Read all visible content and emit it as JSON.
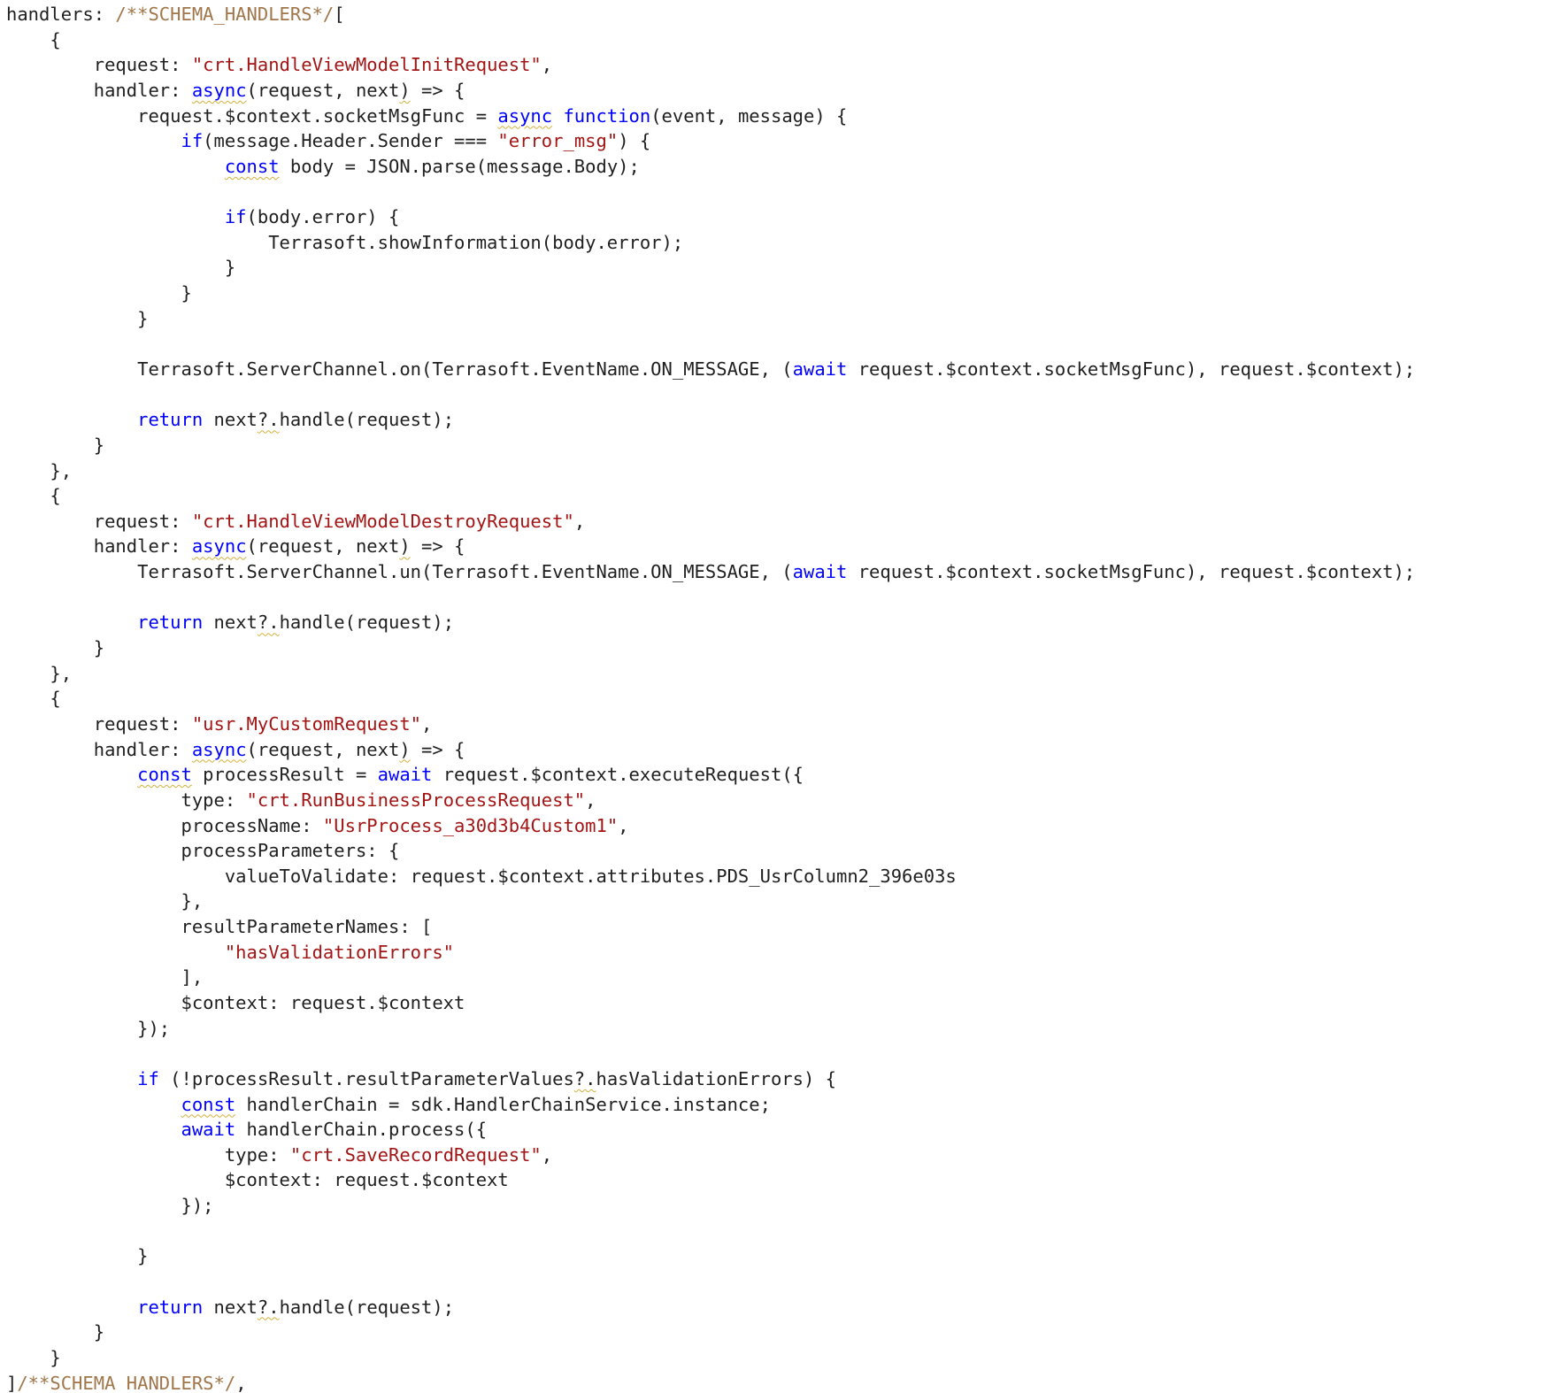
{
  "editor": {
    "colors": {
      "background": "#ffffff",
      "text": "#1f1f1f",
      "keyword": "#0000ff",
      "string": "#a31515",
      "comment": "#a0764a",
      "squiggle": "#d4b13a"
    },
    "lines": [
      [
        {
          "t": "handlers: ",
          "k": "plain"
        },
        {
          "t": "/**SCHEMA_HANDLERS*/",
          "k": "cm"
        },
        {
          "t": "[",
          "k": "plain"
        }
      ],
      [
        {
          "t": "    {",
          "k": "plain"
        }
      ],
      [
        {
          "t": "        request: ",
          "k": "plain"
        },
        {
          "t": "\"crt.HandleViewModelInitRequest\"",
          "k": "str"
        },
        {
          "t": ",",
          "k": "plain"
        }
      ],
      [
        {
          "t": "        handler: ",
          "k": "plain"
        },
        {
          "t": "async",
          "k": "kw",
          "s": true
        },
        {
          "t": "(request, next",
          "k": "plain"
        },
        {
          "t": ")",
          "k": "plain",
          "s": true
        },
        {
          "t": " => {",
          "k": "plain"
        }
      ],
      [
        {
          "t": "            request.$context.socketMsgFunc = ",
          "k": "plain"
        },
        {
          "t": "async",
          "k": "kw",
          "s": true
        },
        {
          "t": " ",
          "k": "plain"
        },
        {
          "t": "function",
          "k": "kw"
        },
        {
          "t": "(event, message) {",
          "k": "plain"
        }
      ],
      [
        {
          "t": "                ",
          "k": "plain"
        },
        {
          "t": "if",
          "k": "kw"
        },
        {
          "t": "(message.Header.Sender === ",
          "k": "plain"
        },
        {
          "t": "\"error_msg\"",
          "k": "str"
        },
        {
          "t": ") {",
          "k": "plain"
        }
      ],
      [
        {
          "t": "                    ",
          "k": "plain"
        },
        {
          "t": "const",
          "k": "kw",
          "s": true
        },
        {
          "t": " body = JSON.parse(message.Body);",
          "k": "plain"
        }
      ],
      [
        {
          "t": "",
          "k": "plain"
        }
      ],
      [
        {
          "t": "                    ",
          "k": "plain"
        },
        {
          "t": "if",
          "k": "kw"
        },
        {
          "t": "(body.error) {",
          "k": "plain"
        }
      ],
      [
        {
          "t": "                        Terrasoft.showInformation(body.error);",
          "k": "plain"
        }
      ],
      [
        {
          "t": "                    }",
          "k": "plain"
        }
      ],
      [
        {
          "t": "                }",
          "k": "plain"
        }
      ],
      [
        {
          "t": "            }",
          "k": "plain"
        }
      ],
      [
        {
          "t": "",
          "k": "plain"
        }
      ],
      [
        {
          "t": "            Terrasoft.ServerChannel.on(Terrasoft.EventName.ON_MESSAGE, (",
          "k": "plain"
        },
        {
          "t": "await",
          "k": "kw"
        },
        {
          "t": " request.$context.socketMsgFunc), request.$context);",
          "k": "plain"
        }
      ],
      [
        {
          "t": "",
          "k": "plain"
        }
      ],
      [
        {
          "t": "            ",
          "k": "plain"
        },
        {
          "t": "return",
          "k": "kw"
        },
        {
          "t": " next",
          "k": "plain"
        },
        {
          "t": "?.",
          "k": "plain",
          "s": true
        },
        {
          "t": "handle(request);",
          "k": "plain"
        }
      ],
      [
        {
          "t": "        }",
          "k": "plain"
        }
      ],
      [
        {
          "t": "    },",
          "k": "plain"
        }
      ],
      [
        {
          "t": "    {",
          "k": "plain"
        }
      ],
      [
        {
          "t": "        request: ",
          "k": "plain"
        },
        {
          "t": "\"crt.HandleViewModelDestroyRequest\"",
          "k": "str"
        },
        {
          "t": ",",
          "k": "plain"
        }
      ],
      [
        {
          "t": "        handler: ",
          "k": "plain"
        },
        {
          "t": "async",
          "k": "kw",
          "s": true
        },
        {
          "t": "(request, next",
          "k": "plain"
        },
        {
          "t": ")",
          "k": "plain",
          "s": true
        },
        {
          "t": " => {",
          "k": "plain"
        }
      ],
      [
        {
          "t": "            Terrasoft.ServerChannel.un(Terrasoft.EventName.ON_MESSAGE, (",
          "k": "plain"
        },
        {
          "t": "await",
          "k": "kw"
        },
        {
          "t": " request.$context.socketMsgFunc), request.$context);",
          "k": "plain"
        }
      ],
      [
        {
          "t": "",
          "k": "plain"
        }
      ],
      [
        {
          "t": "            ",
          "k": "plain"
        },
        {
          "t": "return",
          "k": "kw"
        },
        {
          "t": " next",
          "k": "plain"
        },
        {
          "t": "?.",
          "k": "plain",
          "s": true
        },
        {
          "t": "handle(request);",
          "k": "plain"
        }
      ],
      [
        {
          "t": "        }",
          "k": "plain"
        }
      ],
      [
        {
          "t": "    },",
          "k": "plain"
        }
      ],
      [
        {
          "t": "    {",
          "k": "plain"
        }
      ],
      [
        {
          "t": "        request: ",
          "k": "plain"
        },
        {
          "t": "\"usr.MyCustomRequest\"",
          "k": "str"
        },
        {
          "t": ",",
          "k": "plain"
        }
      ],
      [
        {
          "t": "        handler: ",
          "k": "plain"
        },
        {
          "t": "async",
          "k": "kw",
          "s": true
        },
        {
          "t": "(request, next",
          "k": "plain"
        },
        {
          "t": ")",
          "k": "plain",
          "s": true
        },
        {
          "t": " => {",
          "k": "plain"
        }
      ],
      [
        {
          "t": "            ",
          "k": "plain"
        },
        {
          "t": "const",
          "k": "kw",
          "s": true
        },
        {
          "t": " processResult = ",
          "k": "plain"
        },
        {
          "t": "await",
          "k": "kw"
        },
        {
          "t": " request.$context.executeRequest({",
          "k": "plain"
        }
      ],
      [
        {
          "t": "                type: ",
          "k": "plain"
        },
        {
          "t": "\"crt.RunBusinessProcessRequest\"",
          "k": "str"
        },
        {
          "t": ",",
          "k": "plain"
        }
      ],
      [
        {
          "t": "                processName: ",
          "k": "plain"
        },
        {
          "t": "\"UsrProcess_a30d3b4Custom1\"",
          "k": "str"
        },
        {
          "t": ",",
          "k": "plain"
        }
      ],
      [
        {
          "t": "                processParameters: {",
          "k": "plain"
        }
      ],
      [
        {
          "t": "                    valueToValidate: request.$context.attributes.PDS_UsrColumn2_396e03s",
          "k": "plain"
        }
      ],
      [
        {
          "t": "                },",
          "k": "plain"
        }
      ],
      [
        {
          "t": "                resultParameterNames: [",
          "k": "plain"
        }
      ],
      [
        {
          "t": "                    ",
          "k": "plain"
        },
        {
          "t": "\"hasValidationErrors\"",
          "k": "str"
        }
      ],
      [
        {
          "t": "                ],",
          "k": "plain"
        }
      ],
      [
        {
          "t": "                $context: request.$context",
          "k": "plain"
        }
      ],
      [
        {
          "t": "            });",
          "k": "plain"
        }
      ],
      [
        {
          "t": "",
          "k": "plain"
        }
      ],
      [
        {
          "t": "            ",
          "k": "plain"
        },
        {
          "t": "if",
          "k": "kw"
        },
        {
          "t": " (!processResult.resultParameterValues",
          "k": "plain"
        },
        {
          "t": "?.",
          "k": "plain",
          "s": true
        },
        {
          "t": "hasValidationErrors) {",
          "k": "plain"
        }
      ],
      [
        {
          "t": "                ",
          "k": "plain"
        },
        {
          "t": "const",
          "k": "kw",
          "s": true
        },
        {
          "t": " handlerChain = sdk.HandlerChainService.instance;",
          "k": "plain"
        }
      ],
      [
        {
          "t": "                ",
          "k": "plain"
        },
        {
          "t": "await",
          "k": "kw"
        },
        {
          "t": " handlerChain.process({",
          "k": "plain"
        }
      ],
      [
        {
          "t": "                    type: ",
          "k": "plain"
        },
        {
          "t": "\"crt.SaveRecordRequest\"",
          "k": "str"
        },
        {
          "t": ",",
          "k": "plain"
        }
      ],
      [
        {
          "t": "                    $context: request.$context",
          "k": "plain"
        }
      ],
      [
        {
          "t": "                });",
          "k": "plain"
        }
      ],
      [
        {
          "t": "",
          "k": "plain"
        }
      ],
      [
        {
          "t": "            }",
          "k": "plain"
        }
      ],
      [
        {
          "t": "",
          "k": "plain"
        }
      ],
      [
        {
          "t": "            ",
          "k": "plain"
        },
        {
          "t": "return",
          "k": "kw"
        },
        {
          "t": " next",
          "k": "plain"
        },
        {
          "t": "?.",
          "k": "plain",
          "s": true
        },
        {
          "t": "handle(request);",
          "k": "plain"
        }
      ],
      [
        {
          "t": "        }",
          "k": "plain"
        }
      ],
      [
        {
          "t": "    }",
          "k": "plain"
        }
      ],
      [
        {
          "t": "]",
          "k": "plain"
        },
        {
          "t": "/**SCHEMA_HANDLERS*/",
          "k": "cm"
        },
        {
          "t": ",",
          "k": "plain"
        }
      ]
    ]
  }
}
